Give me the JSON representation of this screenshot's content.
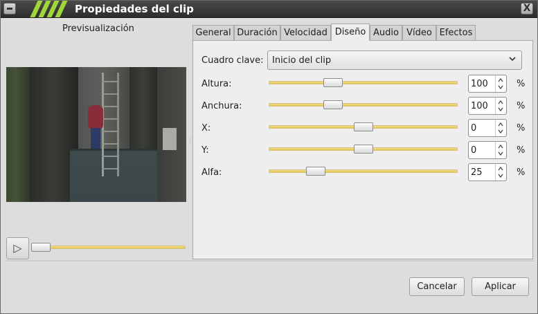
{
  "window": {
    "title": "Propiedades del clip",
    "close_glyph": "X"
  },
  "preview": {
    "label": "Previsualización",
    "play_glyph": "▷",
    "position_fraction": 0
  },
  "tabs": [
    {
      "label": "General",
      "active": false
    },
    {
      "label": "Duración",
      "active": false
    },
    {
      "label": "Velocidad",
      "active": false
    },
    {
      "label": "Diseño",
      "active": true
    },
    {
      "label": "Audio",
      "active": false
    },
    {
      "label": "Vídeo",
      "active": false
    },
    {
      "label": "Efectos",
      "active": false
    }
  ],
  "keyframe": {
    "label": "Cuadro clave:",
    "value": "Inicio del clip"
  },
  "properties": [
    {
      "label": "Altura:",
      "value": "100",
      "unit": "%",
      "slider_fraction": 0.34
    },
    {
      "label": "Anchura:",
      "value": "100",
      "unit": "%",
      "slider_fraction": 0.34
    },
    {
      "label": "X:",
      "value": "0",
      "unit": "%",
      "slider_fraction": 0.5
    },
    {
      "label": "Y:",
      "value": "0",
      "unit": "%",
      "slider_fraction": 0.5
    },
    {
      "label": "Alfa:",
      "value": "25",
      "unit": "%",
      "slider_fraction": 0.25
    }
  ],
  "buttons": {
    "cancel": "Cancelar",
    "apply": "Aplicar"
  },
  "colors": {
    "titlebar_accent": "#9fd63a",
    "slider_track": "#e8c54a"
  }
}
